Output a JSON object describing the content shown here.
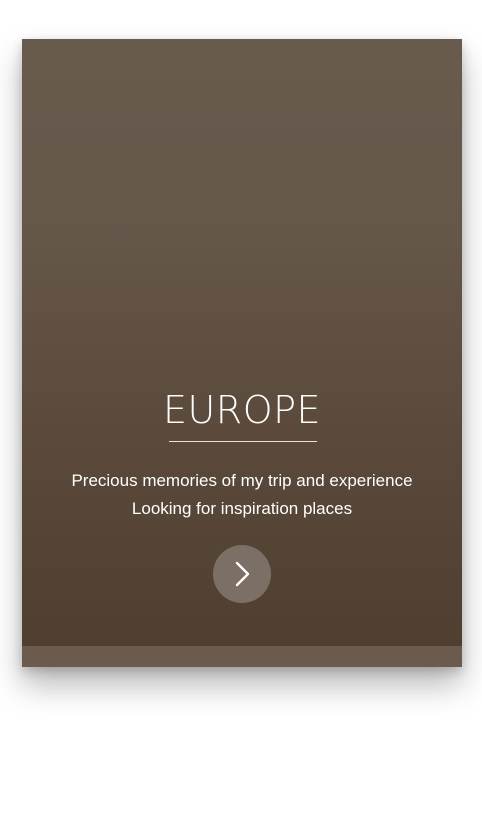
{
  "card": {
    "title": "EUROPE",
    "description_lines": [
      "Precious memories of my trip and experience",
      "Looking for inspiration places"
    ],
    "next_button": {
      "icon": "chevron-right-icon"
    }
  },
  "colors": {
    "hero_top": "#685a4d",
    "hero_bottom": "#4f3f30",
    "footer_bar": "#6a5b4e",
    "button_bg": "#7c6f65",
    "text": "#ffffff"
  }
}
